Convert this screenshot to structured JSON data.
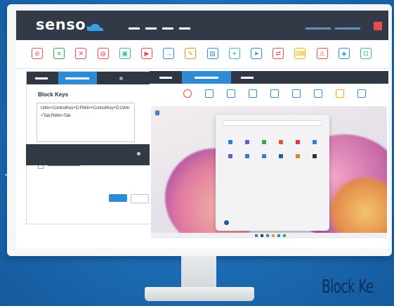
{
  "app": {
    "logo_text": "senso."
  },
  "colors": {
    "background": "#1d6fb6",
    "header": "#313a46",
    "accent": "#2d8cd4",
    "close": "#e84c4c"
  },
  "toolbar_icons": [
    {
      "name": "block-icon",
      "color": "#e84c4c",
      "glyph": "⊘"
    },
    {
      "name": "document-icon",
      "color": "#2fa84f",
      "glyph": "≡"
    },
    {
      "name": "mute-icon",
      "color": "#e0457b",
      "glyph": "✕"
    },
    {
      "name": "web-icon",
      "color": "#e84c4c",
      "glyph": "◍"
    },
    {
      "name": "screenshot-icon",
      "color": "#3bb3a5",
      "glyph": "▣"
    },
    {
      "name": "video-icon",
      "color": "#e84c4c",
      "glyph": "▶"
    },
    {
      "name": "login-icon",
      "color": "#2d8cd4",
      "glyph": "→"
    },
    {
      "name": "edit-icon",
      "color": "#f08a24",
      "glyph": "✎"
    },
    {
      "name": "file-icon",
      "color": "#2d8cd4",
      "glyph": "▤"
    },
    {
      "name": "group-icon",
      "color": "#3bb3a5",
      "glyph": "⚭"
    },
    {
      "name": "send-icon",
      "color": "#2d8cd4",
      "glyph": "➤"
    },
    {
      "name": "usb-icon",
      "color": "#e84c4c",
      "glyph": "⇄"
    },
    {
      "name": "keyboard-icon",
      "color": "#f0b400",
      "glyph": "⌨"
    },
    {
      "name": "warning-icon",
      "color": "#e84c4c",
      "glyph": "⚠"
    },
    {
      "name": "shield-icon",
      "color": "#2d8cd4",
      "glyph": "◈"
    },
    {
      "name": "scan-icon",
      "color": "#3bb3a5",
      "glyph": "⊡"
    }
  ],
  "remote_icons": [
    {
      "name": "block-icon",
      "color": "#e84c4c"
    },
    {
      "name": "list-icon",
      "color": "#2d8cd4"
    },
    {
      "name": "copy-icon",
      "color": "#2d8cd4"
    },
    {
      "name": "info-icon",
      "color": "#2d8cd4"
    },
    {
      "name": "monitor-icon",
      "color": "#2d8cd4"
    },
    {
      "name": "grid-icon",
      "color": "#2d8cd4"
    },
    {
      "name": "camera-icon",
      "color": "#2d8cd4"
    },
    {
      "name": "settings-icon",
      "color": "#f0b400"
    },
    {
      "name": "external-link-icon",
      "color": "#2d8cd4"
    }
  ],
  "block_keys": {
    "title": "Block Keys",
    "value": "LWin+ControlKey+D;RWin+ControlKey+D;LWin+Tab;RWin+Tab"
  },
  "footer": {
    "label": "Block Ke"
  }
}
